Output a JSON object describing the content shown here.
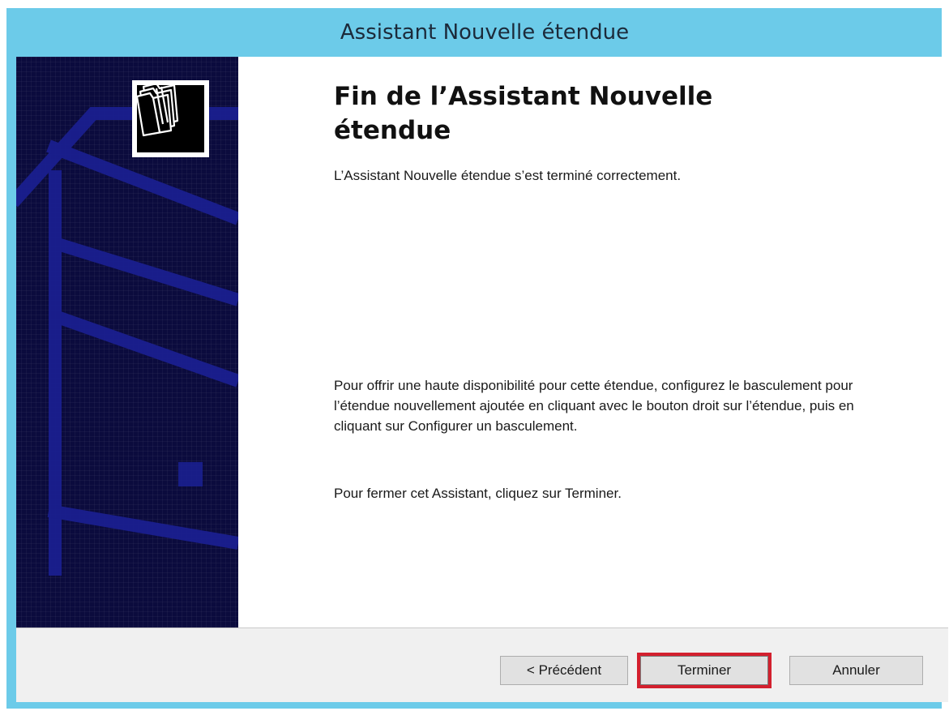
{
  "window": {
    "title": "Assistant Nouvelle étendue"
  },
  "banner": {
    "icon": "folders-icon",
    "background_color": "#0b0b3d",
    "accent_color": "#1a1f8f"
  },
  "content": {
    "heading": "Fin de l’Assistant Nouvelle étendue",
    "completion_text": "L’Assistant Nouvelle étendue s’est terminé correctement.",
    "failover_text": "Pour offrir une haute disponibilité pour cette étendue, configurez le basculement pour l’étendue nouvellement ajoutée en cliquant avec le bouton droit sur l’étendue, puis en cliquant sur Configurer un basculement.",
    "close_text": "Pour fermer cet Assistant, cliquez sur Terminer."
  },
  "buttons": {
    "previous_label": "< Précédent",
    "finish_label": "Terminer",
    "cancel_label": "Annuler",
    "highlight_color": "#d3202e"
  }
}
